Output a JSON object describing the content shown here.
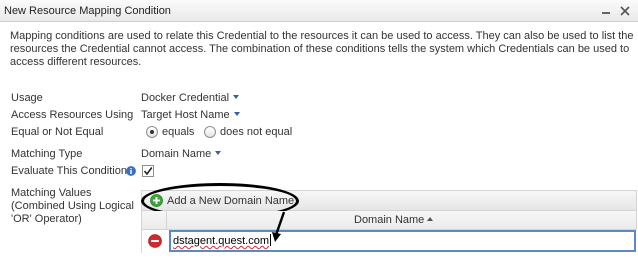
{
  "dialog": {
    "title": "New Resource Mapping Condition",
    "description_lines": [
      "Mapping conditions are used to relate this Credential to the resources it can be used to access. They can also be used to list the",
      "resources the Credential cannot access. The combination of these conditions tells the system which Credentials can be used to",
      "access different resources."
    ]
  },
  "form": {
    "usage": {
      "label": "Usage",
      "value": "Docker Credential"
    },
    "access_resources": {
      "label": "Access Resources Using",
      "value": "Target Host Name"
    },
    "equality": {
      "label": "Equal or Not Equal",
      "option_equals": "equals",
      "option_not_equals": "does not equal",
      "selected": "equals"
    },
    "matching_type": {
      "label": "Matching Type",
      "value": "Domain Name"
    },
    "evaluate": {
      "label": "Evaluate This Condition",
      "checked": true
    },
    "matching_values": {
      "label_lines": [
        "Matching Values",
        "(Combined Using Logical",
        "'OR' Operator)"
      ],
      "add_label": "Add a New Domain Name",
      "column_header": "Domain Name",
      "sort": "ascending",
      "rows": [
        {
          "value": "dstagent.quest.com"
        }
      ]
    }
  },
  "colors": {
    "link_arrow": "#3a5fa0",
    "info": "#3b6fc4",
    "add_green": "#3aa53a",
    "remove_red": "#d22a2a",
    "input_border": "#5b88c7",
    "annotation": "#000000"
  },
  "icons": {
    "minimize": "minimize-icon",
    "close": "close-icon",
    "info": "info-icon",
    "add": "plus-circle-icon",
    "remove": "minus-circle-icon"
  }
}
